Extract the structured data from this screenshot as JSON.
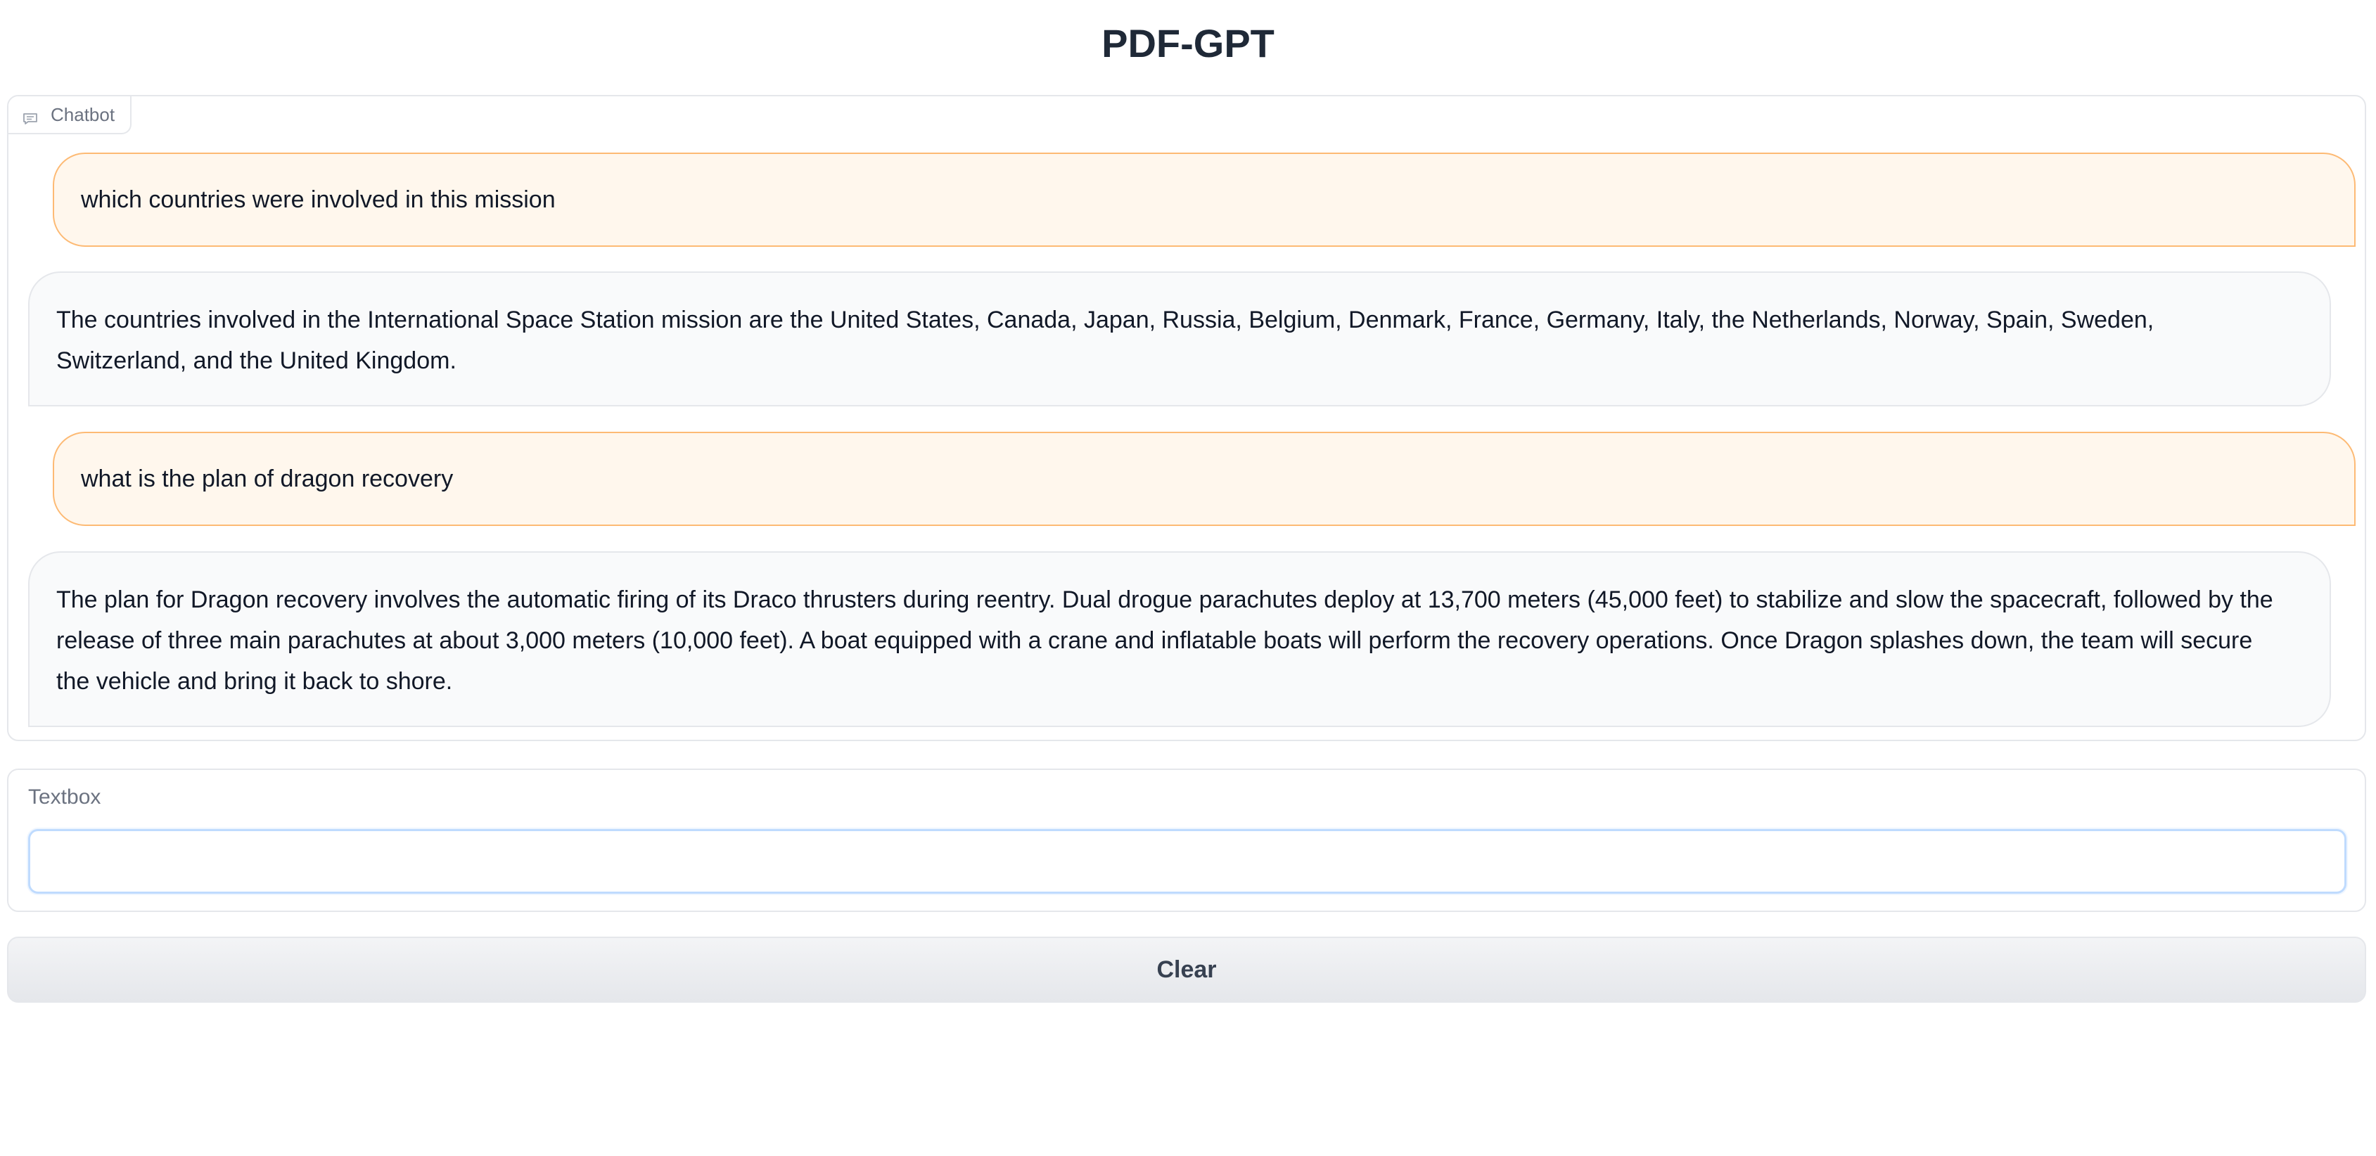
{
  "app": {
    "title": "PDF-GPT"
  },
  "chatbot": {
    "label": "Chatbot",
    "label_icon": "chat-bubble-icon",
    "messages": [
      {
        "role": "user",
        "text": "which countries were involved in this mission"
      },
      {
        "role": "bot",
        "text": "The countries involved in the International Space Station mission are the United States, Canada, Japan, Russia, Belgium, Denmark, France, Germany, Italy, the Netherlands, Norway, Spain, Sweden, Switzerland, and the United Kingdom."
      },
      {
        "role": "user",
        "text": "what is the plan of dragon recovery"
      },
      {
        "role": "bot",
        "text": "The plan for Dragon recovery involves the automatic firing of its Draco thrusters during reentry. Dual drogue parachutes deploy at 13,700 meters (45,000 feet) to stabilize and slow the spacecraft, followed by the release of three main parachutes at about 3,000 meters (10,000 feet). A boat equipped with a crane and inflatable boats will perform the recovery operations. Once Dragon splashes down, the team will secure the vehicle and bring it back to shore."
      }
    ]
  },
  "textbox": {
    "label": "Textbox",
    "value": "",
    "placeholder": ""
  },
  "actions": {
    "clear_label": "Clear"
  },
  "colors": {
    "user_bubble_bg": "#fff7ed",
    "user_bubble_border": "#fdba74",
    "bot_bubble_bg": "#f9fafb",
    "panel_border": "#e5e7eb",
    "input_focus_border": "#bfdbfe"
  }
}
